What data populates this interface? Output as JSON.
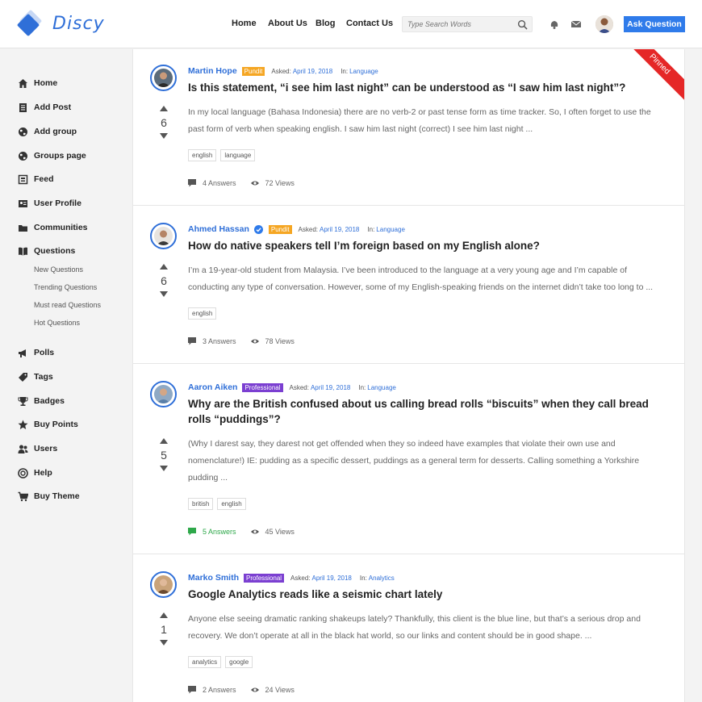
{
  "header": {
    "logo_text": "Discy",
    "nav": [
      "Home",
      "About Us",
      "Blog",
      "Contact Us"
    ],
    "search_placeholder": "Type Search Words",
    "ask_button": "Ask Question",
    "accent": "#2f7bea"
  },
  "sidebar": {
    "items": [
      {
        "label": "Home",
        "icon": "home-icon"
      },
      {
        "label": "Add Post",
        "icon": "document-icon"
      },
      {
        "label": "Add group",
        "icon": "globe-icon"
      },
      {
        "label": "Groups page",
        "icon": "globe-icon"
      },
      {
        "label": "Feed",
        "icon": "feed-icon"
      },
      {
        "label": "User Profile",
        "icon": "profile-card-icon"
      },
      {
        "label": "Communities",
        "icon": "folder-icon"
      },
      {
        "label": "Questions",
        "icon": "book-icon"
      }
    ],
    "sub_items": [
      "New Questions",
      "Trending Questions",
      "Must read Questions",
      "Hot Questions"
    ],
    "items2": [
      {
        "label": "Polls",
        "icon": "megaphone-icon"
      },
      {
        "label": "Tags",
        "icon": "tag-icon"
      },
      {
        "label": "Badges",
        "icon": "trophy-icon"
      },
      {
        "label": "Buy Points",
        "icon": "star-icon"
      },
      {
        "label": "Users",
        "icon": "users-icon"
      },
      {
        "label": "Help",
        "icon": "lifebuoy-icon"
      },
      {
        "label": "Buy Theme",
        "icon": "cart-icon"
      }
    ]
  },
  "questions": [
    {
      "author": "Martin Hope",
      "badge": "Pundit",
      "badge_color": "#f5a623",
      "asked_label": "Asked:",
      "date": "April 19, 2018",
      "in_label": "In:",
      "category": "Language",
      "title": "Is this statement, “i see him last night” can be understood as “I saw him last night”?",
      "excerpt": "In my local language (Bahasa Indonesia) there are no verb-2 or past tense form as time tracker. So, I often forget to use the past form of verb when speaking english. I saw him last night (correct) I see him last night ...",
      "tags": [
        "english",
        "language"
      ],
      "votes": "6",
      "answers": "4 Answers",
      "views": "72 Views",
      "pinned": "Pinned"
    },
    {
      "author": "Ahmed Hassan",
      "badge": "Pundit",
      "badge_color": "#f5a623",
      "asked_label": "Asked:",
      "date": "April 19, 2018",
      "in_label": "In:",
      "category": "Language",
      "title": "How do native speakers tell I’m foreign based on my English alone?",
      "excerpt": "I’m a 19-year-old student from Malaysia. I’ve been introduced to the language at a very young age and I’m capable of conducting any type of conversation. However, some of my English-speaking friends on the internet didn’t take too long to ...",
      "tags": [
        "english"
      ],
      "votes": "6",
      "answers": "3 Answers",
      "views": "78 Views"
    },
    {
      "author": "Aaron Aiken",
      "badge": "Professional",
      "badge_color": "#7b3fd1",
      "asked_label": "Asked:",
      "date": "April 19, 2018",
      "in_label": "In:",
      "category": "Language",
      "title": "Why are the British confused about us calling bread rolls “biscuits” when they call bread rolls “puddings”?",
      "excerpt": "(Why I darest say, they darest not get offended when they so indeed have examples that violate their own use and nomenclature!) IE: pudding as a specific dessert, puddings as a general term for desserts. Calling something a Yorkshire pudding ...",
      "tags": [
        "british",
        "english"
      ],
      "votes": "5",
      "answers": "5 Answers",
      "views": "45 Views",
      "answered_color": "#2ea84a"
    },
    {
      "author": "Marko Smith",
      "badge": "Professional",
      "badge_color": "#7b3fd1",
      "asked_label": "Asked:",
      "date": "April 19, 2018",
      "in_label": "In:",
      "category": "Analytics",
      "title": "Google Analytics reads like a seismic chart lately",
      "excerpt": "Anyone else seeing dramatic ranking shakeups lately? Thankfully, this client is the blue line, but that’s a serious drop and recovery. We don’t operate at all in the black hat world, so our links and content should be in good shape. ...",
      "tags": [
        "analytics",
        "google"
      ],
      "votes": "1",
      "answers": "2 Answers",
      "views": "24 Views"
    }
  ]
}
